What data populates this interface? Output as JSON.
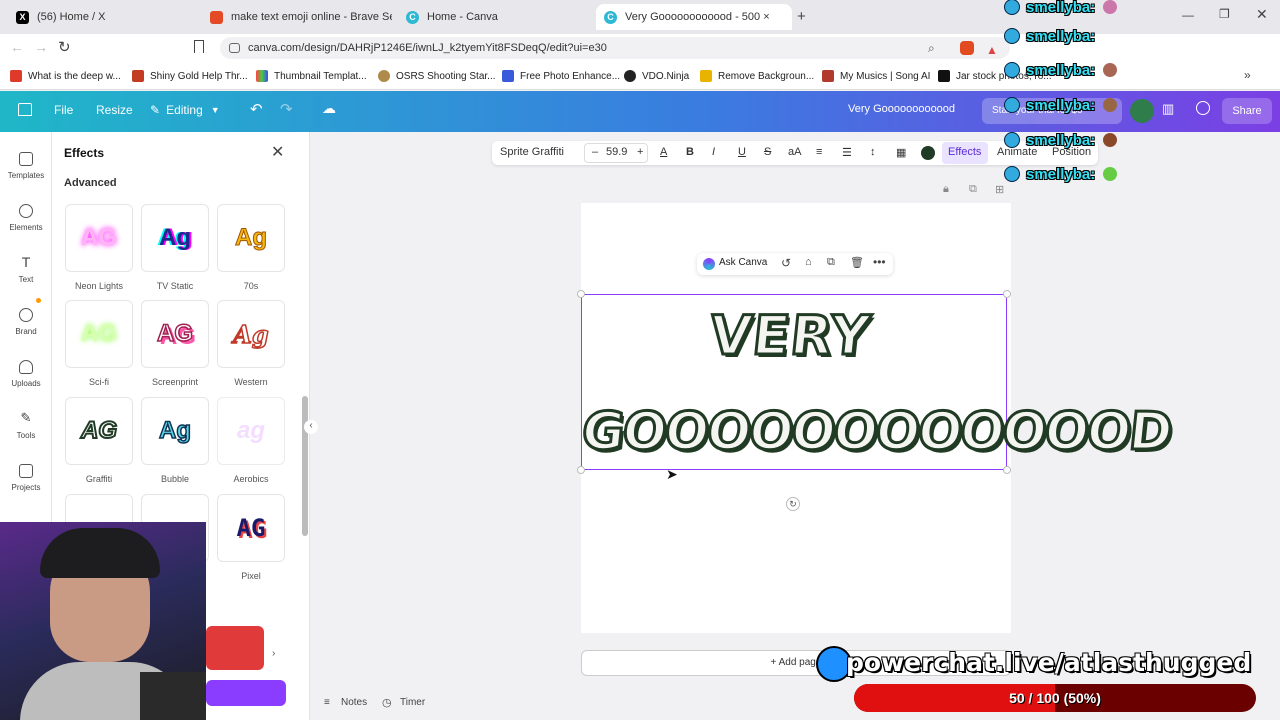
{
  "browser": {
    "tabs": [
      {
        "label": "(56) Home / X",
        "favicon": "x-logo-icon"
      },
      {
        "label": "make text emoji online - Brave Search",
        "favicon": "brave-icon"
      },
      {
        "label": "Home - Canva",
        "favicon": "canva-icon"
      },
      {
        "label": "Very Goooooooooood - 500 ×",
        "favicon": "canva-icon",
        "active": true
      }
    ],
    "url": "canva.com/design/DAHRjP1246E/iwnLJ_k2tyemYit8FSDeqQ/edit?ui=e30",
    "bookmarks": [
      "What is the deep w...",
      "Shiny Gold Help Thr...",
      "Thumbnail Templat...",
      "OSRS Shooting Star...",
      "Free Photo Enhance...",
      "VDO.Ninja",
      "Remove Backgroun...",
      "My Musics | Song AI",
      "Jar stock photos, ro..."
    ]
  },
  "canva_header": {
    "file": "File",
    "resize": "Resize",
    "editing": "Editing",
    "doc_title": "Very Goooooooooood",
    "trial": "Start your trial for $0",
    "share": "Share"
  },
  "rail": [
    {
      "label": "Templates",
      "icon": "templates-icon"
    },
    {
      "label": "Elements",
      "icon": "elements-icon"
    },
    {
      "label": "Text",
      "icon": "text-icon"
    },
    {
      "label": "Brand",
      "icon": "brand-icon"
    },
    {
      "label": "Uploads",
      "icon": "uploads-icon"
    },
    {
      "label": "Tools",
      "icon": "tools-icon"
    },
    {
      "label": "Projects",
      "icon": "projects-icon"
    }
  ],
  "effects_panel": {
    "title": "Effects",
    "section": "Advanced",
    "items": [
      {
        "label": "Neon Lights",
        "sample": "AG"
      },
      {
        "label": "TV Static",
        "sample": "Ag"
      },
      {
        "label": "70s",
        "sample": "Ag"
      },
      {
        "label": "Sci-fi",
        "sample": "AG"
      },
      {
        "label": "Screenprint",
        "sample": "AG"
      },
      {
        "label": "Western",
        "sample": "Ag"
      },
      {
        "label": "Graffiti",
        "sample": "AG"
      },
      {
        "label": "Bubble",
        "sample": "Ag"
      },
      {
        "label": "Aerobics",
        "sample": "ag"
      },
      {
        "label": "",
        "sample": ""
      },
      {
        "label": "",
        "sample": ""
      },
      {
        "label": "Pixel",
        "sample": "AG"
      }
    ]
  },
  "toolbar": {
    "font": "Sprite Graffiti",
    "size": "59.9",
    "minus": "–",
    "plus": "+",
    "bold": "B",
    "italic": "I",
    "underline": "U",
    "strike": "S",
    "case": "aA",
    "effects": "Effects",
    "animate": "Animate",
    "position": "Position",
    "color": "#1f3b25"
  },
  "canvas": {
    "ask_canva": "Ask Canva",
    "line1": "VERY",
    "line2": "GOOOOOOOOOOOOD",
    "add_page": "+ Add page"
  },
  "footer": {
    "notes": "Notes",
    "timer": "Timer"
  },
  "overlay": {
    "chat_user": "smellyba:",
    "chat_count": 6,
    "powerchat": "powerchat.live/atlasthugged",
    "progress_text": "50 / 100 (50%)",
    "progress": 0.5
  }
}
